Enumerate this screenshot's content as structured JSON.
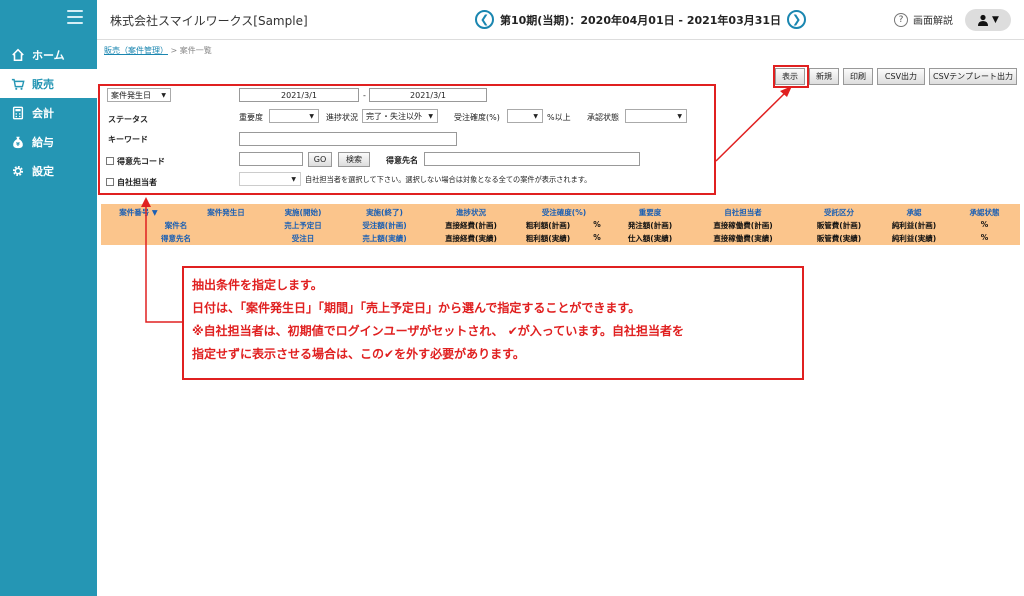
{
  "sidebar": {
    "items": [
      {
        "label": "ホーム",
        "icon": "home-icon"
      },
      {
        "label": "販売",
        "icon": "cart-icon"
      },
      {
        "label": "会計",
        "icon": "calculator-icon"
      },
      {
        "label": "給与",
        "icon": "money-bag-icon"
      },
      {
        "label": "設定",
        "icon": "gear-icon"
      }
    ],
    "active_index": 1
  },
  "header": {
    "company": "株式会社スマイルワークス[Sample]",
    "period": "第10期(当期)：2020年04月01日 - 2021年03月31日",
    "help_label": "画面解説",
    "prev_icon": "chevron-left-icon",
    "next_icon": "chevron-right-icon"
  },
  "breadcrumb": {
    "link": "販売（案件管理）",
    "separator": ">",
    "current": "案件一覧"
  },
  "actions": [
    "表示",
    "新規",
    "印刷",
    "CSV出力",
    "CSVテンプレート出力"
  ],
  "filter": {
    "date_type": "案件発生日",
    "date_from": "2021/3/1",
    "date_sep": "-",
    "date_to": "2021/3/1",
    "status_label": "ステータス",
    "importance_label": "重要度",
    "progress_label": "進捗状況",
    "progress_value": "完了・失注以外",
    "certainty_label": "受注確度(%)",
    "certainty_suffix": "%以上",
    "approval_label": "承認状態",
    "keyword_label": "キーワード",
    "customer_code_label": "得意先コード",
    "go_label": "GO",
    "search_label": "検索",
    "customer_name_label": "得意先名",
    "own_staff_label": "自社担当者",
    "own_staff_note": "自社担当者を選択して下さい。選択しない場合は対象となる全ての案件が表示されます。"
  },
  "table_header": {
    "row1": [
      "案件番号 ▼",
      "案件発生日",
      "実施(開始)",
      "実施(終了)",
      "進捗状況",
      "受注確度(%)",
      "重要度",
      "自社担当者",
      "受託区分",
      "承認",
      "承認状態"
    ],
    "row2": [
      "案件名",
      "売上予定日",
      "受注額(計画)",
      "直接経費(計画)",
      "粗利額(計画)",
      "%",
      "発注額(計画)",
      "直接稼働費(計画)",
      "販管費(計画)",
      "純利益(計画)",
      "%"
    ],
    "row3": [
      "得意先名",
      "受注日",
      "売上額(実績)",
      "直接経費(実績)",
      "粗利額(実績)",
      "%",
      "仕入額(実績)",
      "直接稼働費(実績)",
      "販管費(実績)",
      "純利益(実績)",
      "%"
    ]
  },
  "annotation": {
    "line1": "抽出条件を指定します。",
    "line2": "日付は、「案件発生日」「期間」「売上予定日」から選んで指定することができます。",
    "line3a": "※自社担当者は、初期値でログインユーザがセットされ、",
    "line3b": "が入っています。自社担当者を",
    "line4a": "指定せずに表示させる場合は、この",
    "line4b": "を外す必要があります。"
  },
  "colors": {
    "sidebar": "#2596b4",
    "accent_red": "#e02020",
    "table_header_bg": "#fbc58c",
    "link_blue": "#1a5fb4"
  }
}
